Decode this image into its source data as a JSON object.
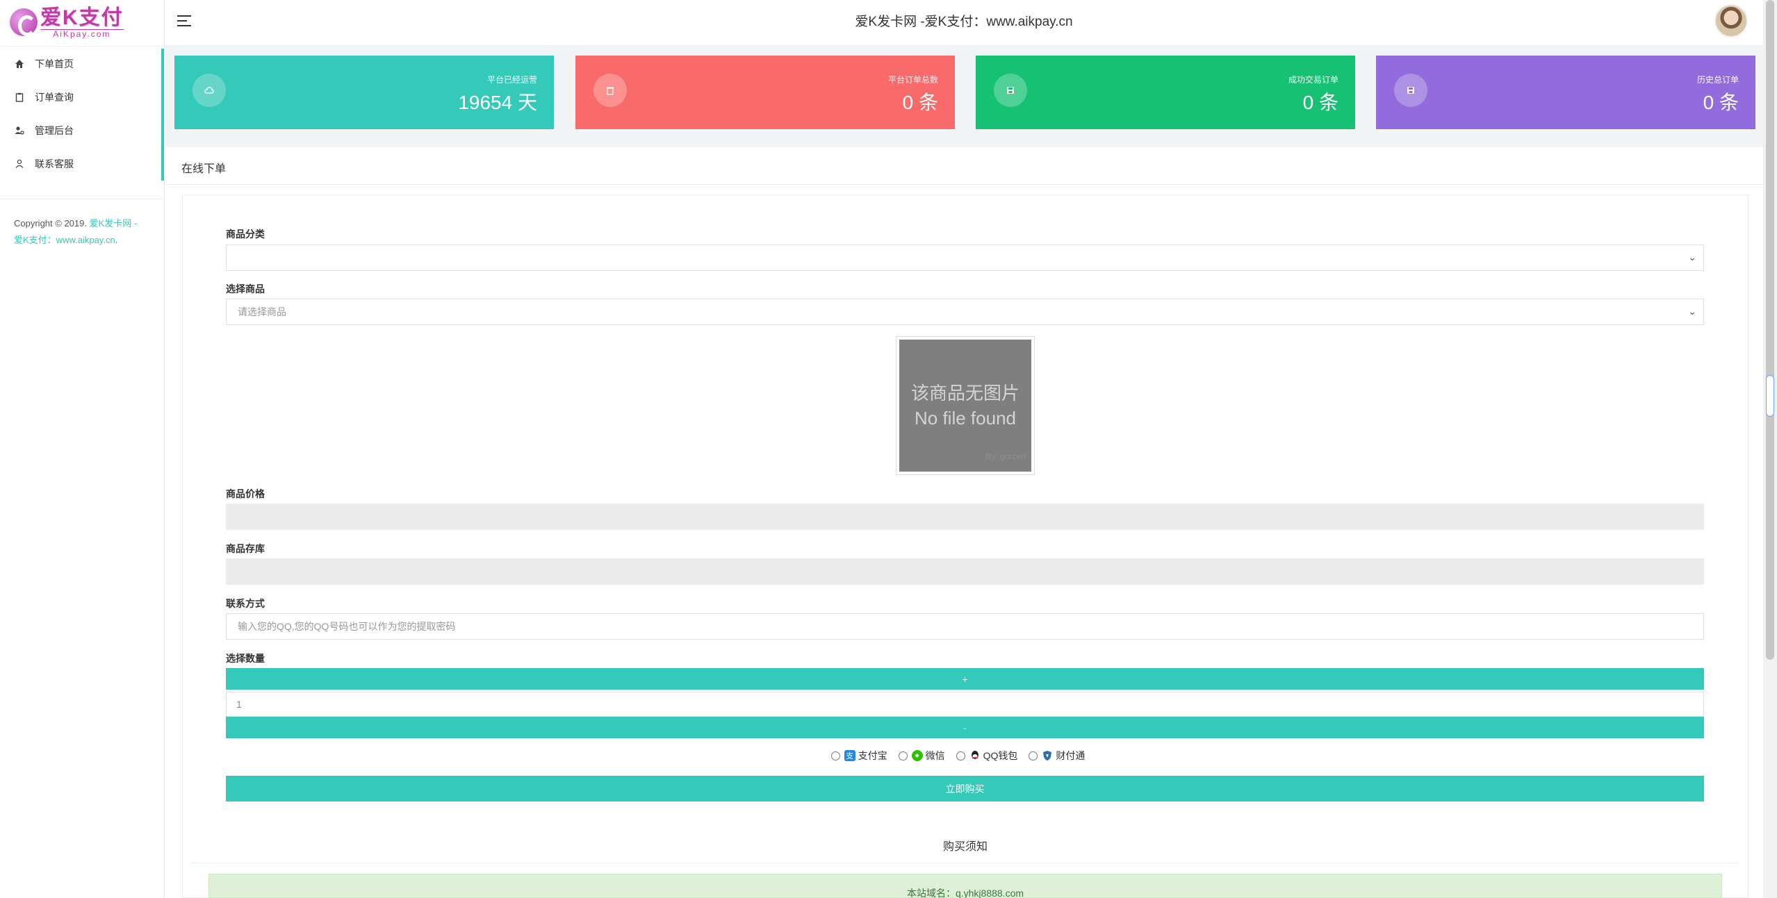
{
  "app": {
    "logo_text": "爱K支付",
    "logo_sub": "AiKpay.com",
    "top_title": "爱K发卡网 -爱K支付：www.aikpay.cn"
  },
  "sidebar": {
    "items": [
      {
        "label": "下单首页",
        "icon": "home-icon"
      },
      {
        "label": "订单查询",
        "icon": "clipboard-icon"
      },
      {
        "label": "管理后台",
        "icon": "user-gear-icon"
      },
      {
        "label": "联系客服",
        "icon": "user-icon"
      }
    ],
    "copyright_prefix": "Copyright © 2019. ",
    "copyright_link1": "爱K发卡网 -",
    "copyright_link2": "爱K支付：www.aikpay.cn",
    "copyright_suffix": "."
  },
  "stats": [
    {
      "label": "平台已经运营",
      "value": "19654 天",
      "color": "#34c9b9",
      "icon": "cloud-icon"
    },
    {
      "label": "平台订单总数",
      "value": "0 条",
      "color": "#f96b6b",
      "icon": "trash-icon"
    },
    {
      "label": "成功交易订单",
      "value": "0 条",
      "color": "#16c173",
      "icon": "save-icon"
    },
    {
      "label": "历史总订单",
      "value": "0 条",
      "color": "#926cdd",
      "icon": "save-icon"
    }
  ],
  "panel": {
    "title": "在线下单"
  },
  "form": {
    "category_label": "商品分类",
    "category_value": "",
    "product_label": "选择商品",
    "product_placeholder": "请选择商品",
    "noimage_cn": "该商品无图片",
    "noimage_en": "No file found",
    "noimage_by": "By: gorcen",
    "price_label": "商品价格",
    "stock_label": "商品存库",
    "contact_label": "联系方式",
    "contact_placeholder": "输入您的QQ,您的QQ号码也可以作为您的提取密码",
    "quantity_label": "选择数量",
    "plus_label": "+",
    "quantity_value": "1",
    "minus_label": "-",
    "payments": [
      {
        "label": "支付宝",
        "icon": "alipay-icon",
        "color": "#1e88e5"
      },
      {
        "label": "微信",
        "icon": "wechat-icon",
        "color": "#2dc100"
      },
      {
        "label": "QQ钱包",
        "icon": "qq-icon",
        "color": "#222222"
      },
      {
        "label": "财付通",
        "icon": "tenpay-icon",
        "color": "#2a6db5"
      }
    ],
    "buy_label": "立即购买"
  },
  "notice": {
    "title": "购买须知",
    "domain_text": "本站域名：q.yhkj8888.com"
  }
}
